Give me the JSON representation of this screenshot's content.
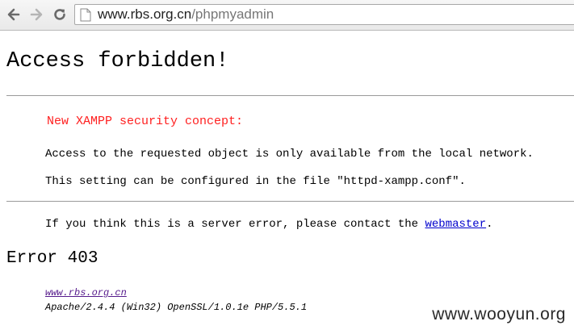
{
  "browser": {
    "url_host": "www.rbs.org.cn",
    "url_path": "/phpmyadmin",
    "icons": [
      "back-icon",
      "forward-icon",
      "reload-icon",
      "page-icon"
    ]
  },
  "page": {
    "title": "Access forbidden!",
    "concept": "New XAMPP security concept:",
    "line1": "Access to the requested object is only available from the local network.",
    "line2": "This setting can be configured in the file \"httpd-xampp.conf\".",
    "contact_prefix": "If you think this is a server error, please contact the ",
    "contact_link": "webmaster",
    "contact_suffix": ".",
    "error_title": "Error 403",
    "address_link": "www.rbs.org.cn",
    "server_signature": "Apache/2.4.4 (Win32) OpenSSL/1.0.1e PHP/5.5.1"
  },
  "watermark": "www.wooyun.org",
  "colors": {
    "concept_red": "#ff2020",
    "link_blue": "#0000cc",
    "visited_link": "#551a8b"
  }
}
